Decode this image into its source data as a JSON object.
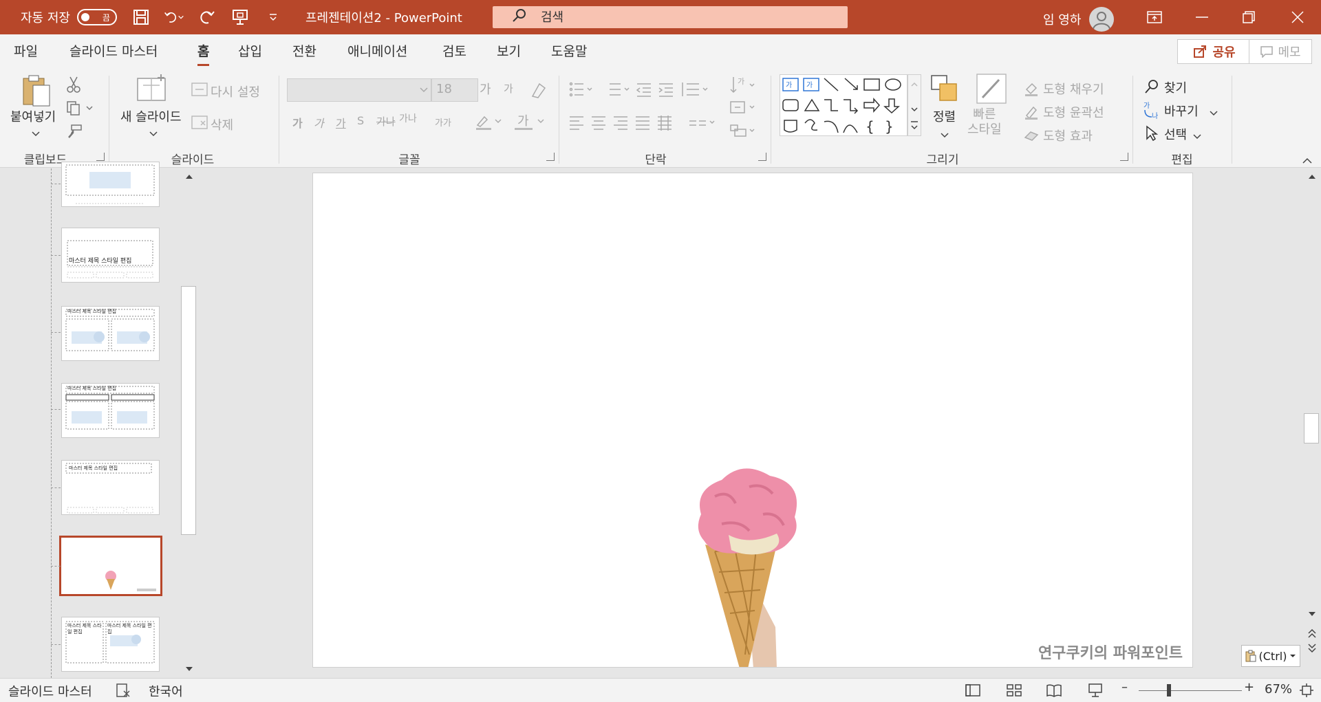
{
  "titlebar": {
    "autosave_label": "자동 저장",
    "autosave_state": "끔",
    "doc_title": "프레젠테이션2  -  PowerPoint",
    "search_placeholder": "검색",
    "user_name": "임 영하"
  },
  "tabs": [
    "파일",
    "슬라이드 마스터",
    "홈",
    "삽입",
    "전환",
    "애니메이션",
    "검토",
    "보기",
    "도움말"
  ],
  "active_tab": "홈",
  "share_label": "공유",
  "memo_label": "메모",
  "ribbon": {
    "clipboard": {
      "group": "클립보드",
      "paste": "붙여넣기"
    },
    "slides": {
      "group": "슬라이드",
      "new_slide": "새 슬라이드",
      "reset": "다시 설정",
      "delete": "삭제"
    },
    "font": {
      "group": "글꼴",
      "size": "18",
      "b1": "가",
      "b2": "가",
      "b3": "가",
      "b4": "S",
      "b5": "가나",
      "b6": "가가",
      "grow": "가",
      "shrink": "가"
    },
    "paragraph": {
      "group": "단락"
    },
    "drawing": {
      "group": "그리기",
      "arrange": "정렬",
      "quick_styles": "빠른\n스타일",
      "fill": "도형 채우기",
      "outline": "도형 윤곽선",
      "effects": "도형 효과"
    },
    "editing": {
      "group": "편집",
      "find": "찾기",
      "replace": "바꾸기",
      "select": "선택"
    }
  },
  "thumbnails": {
    "t2_text": "마스터 제목 스타일 편집",
    "t3_text": "마스터 제목 스타일 편집",
    "t4_text": "마스터 제목 스타일 편집",
    "t5_text": "마스터 제목 스타일 편집",
    "t7_left": "마스터 제목 스타일 편집",
    "t7_right": "마스터 제목 스타일 편집"
  },
  "slide": {
    "watermark": "연구쿠키의 파워포인트"
  },
  "paste_ctrl": "(Ctrl)",
  "statusbar": {
    "view": "슬라이드 마스터",
    "language": "한국어",
    "zoom": "67%"
  },
  "colors": {
    "accent": "#b7472a",
    "search_bg": "#f8c3b2",
    "ribbon_bg": "#f3f3f3"
  }
}
